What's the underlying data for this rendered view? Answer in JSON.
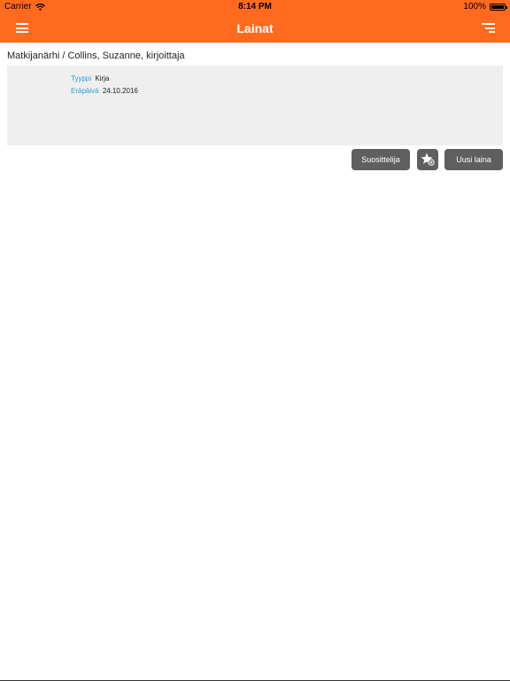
{
  "status_bar": {
    "carrier": "Carrier",
    "time": "8:14 PM",
    "battery": "100%"
  },
  "nav": {
    "title": "Lainat"
  },
  "loan": {
    "title": "Matkijanärhi / Collins, Suzanne, kirjoittaja",
    "type_label": "Tyyppi",
    "type_value": "Kirja",
    "due_label": "Eräpäivä",
    "due_value": "24.10.2016"
  },
  "actions": {
    "recommender_label": "Suosittelija",
    "favorite_icon": "star-add-icon",
    "new_loan_label": "Uusi laina"
  },
  "colors": {
    "accent": "#ff6a1f",
    "label_blue": "#2a9fd6",
    "card_bg": "#efefef",
    "button_bg": "#5f5f5f"
  }
}
